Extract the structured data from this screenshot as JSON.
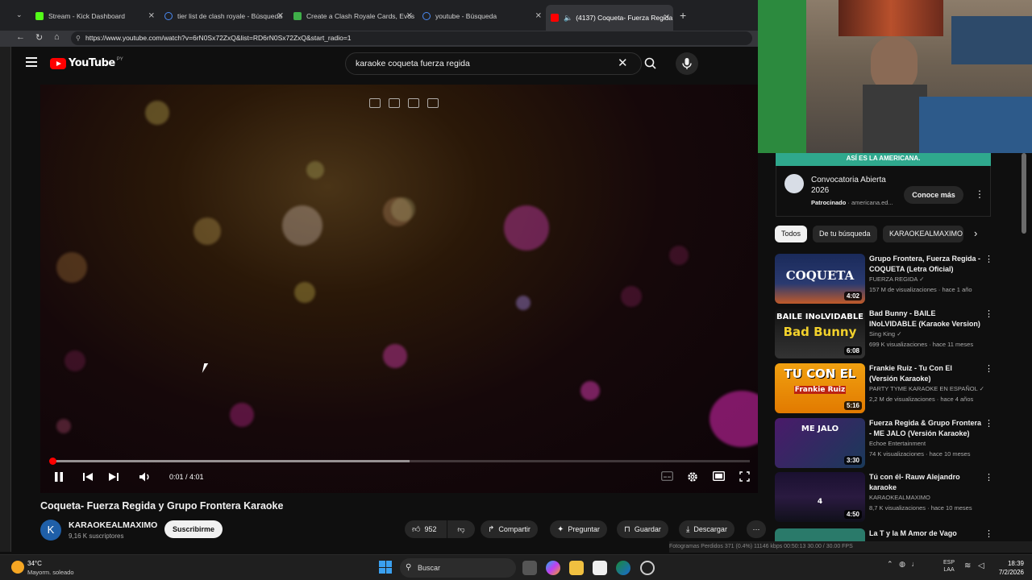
{
  "browser": {
    "tabs": [
      {
        "label": "Stream - Kick Dashboard",
        "color": "#53fc18"
      },
      {
        "label": "tier list de clash royale - Búsqueda",
        "color": "#4a8af4"
      },
      {
        "label": "Create a Clash Royale Cards, Evos",
        "color": "#3fae49"
      },
      {
        "label": "youtube - Búsqueda",
        "color": "#4a8af4"
      },
      {
        "label": "(4137) Coqueta- Fuerza Regida",
        "color": "#ff0000"
      }
    ],
    "new_tab": "+",
    "url": "https://www.youtube.com/watch?v=6rN0Sx72ZxQ&list=RD6rN0Sx72ZxQ&start_radio=1"
  },
  "youtube": {
    "logo_text": "YouTube",
    "country_code": "PY",
    "search_value": "karaoke coqueta fuerza regida"
  },
  "player": {
    "played_fraction": 0.004,
    "buffered_fraction": 0.514,
    "time_display": "0:01 / 4:01"
  },
  "video": {
    "title": "Coqueta- Fuerza Regida y Grupo Frontera Karaoke",
    "channel_initial": "K",
    "channel": "KARAOKEALMAXIMO",
    "subscribers": "9,16 K suscriptores",
    "subscribe_label": "Suscribirme",
    "likes": "952",
    "share_label": "Compartir",
    "ask_label": "Preguntar",
    "save_label": "Guardar",
    "download_label": "Descargar"
  },
  "ad": {
    "banner": "ASÍ ES LA AMERICANA.",
    "title": "Convocatoria Abierta 2026",
    "sponsored": "Patrocinado",
    "domain": "americana.ed...",
    "cta": "Conoce más"
  },
  "chips": [
    "Todos",
    "De tu búsqueda",
    "KARAOKEALMAXIMO"
  ],
  "recommendations": [
    {
      "title": "Grupo Frontera, Fuerza Regida - COQUETA (Letra Oficial)",
      "channel": "FUERZA REGIDA",
      "meta": "157 M de visualizaciones · hace 1 año",
      "duration": "4:02",
      "thumb_text": "COQUETA"
    },
    {
      "title": "Bad Bunny - BAILE INoLVIDABLE (Karaoke Version)",
      "channel": "Sing King",
      "meta": "699 K visualizaciones · hace 11 meses",
      "duration": "6:08",
      "thumb_text": "BAILE INoLVIDABLE",
      "thumb_text2": "Bad Bunny"
    },
    {
      "title": "Frankie Ruiz - Tu Con El (Versión Karaoke)",
      "channel": "PARTY TYME KARAOKE EN ESPAÑOL",
      "meta": "2,2 M de visualizaciones · hace 4 años",
      "duration": "5:16",
      "thumb_text": "TU CON EL",
      "thumb_text2": "Frankie Ruiz"
    },
    {
      "title": "Fuerza Regida & Grupo Frontera - ME JALO (Versión Karaoke)",
      "channel": "Echoe Entertainment",
      "meta": "74 K visualizaciones · hace 10 meses",
      "duration": "3:30",
      "thumb_text": "ME JALO"
    },
    {
      "title": "Tú con él- Rauw Alejandro karaoke",
      "channel": "KARAOKEALMAXIMO",
      "meta": "8,7 K visualizaciones · hace 10 meses",
      "duration": "4:50",
      "thumb_text": "4"
    },
    {
      "title": "La T y la M Amor de Vago",
      "channel": "",
      "meta": "",
      "duration": "",
      "thumb_text": ""
    }
  ],
  "obs_status": "Fotogramas Perdidos 371 (0.4%)     11146 kbps     00:50:13     30.00 / 30.00 FPS",
  "taskbar": {
    "temp": "34°C",
    "weather": "Mayorm. soleado",
    "search_label": "Buscar",
    "lang_top": "ESP",
    "lang_bottom": "LAA",
    "time": "18:39",
    "date": "7/2/2026"
  },
  "colors": {
    "accent": "#ff0000",
    "ad_green": "#2fa88d"
  }
}
